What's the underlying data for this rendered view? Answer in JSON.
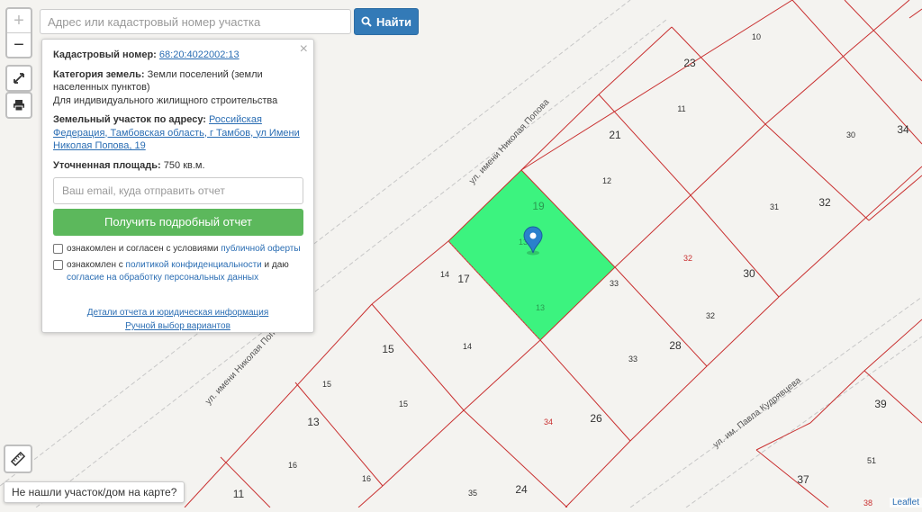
{
  "search": {
    "placeholder": "Адрес или кадастровый номер участка",
    "button_label": "Найти"
  },
  "controls": {
    "zoom_in": "+",
    "zoom_out": "−"
  },
  "popup": {
    "close": "×",
    "cadastral_label": "Кадастровый номер:",
    "cadastral_number": "68:20:4022002:13",
    "category_label": "Категория земель:",
    "category_value": "Земли поселений (земли населенных пунктов)",
    "usage": "Для индивидуального жилищного строительства",
    "address_label": "Земельный участок по адресу:",
    "address_value": "Российская Федерация, Тамбовская область, г Тамбов, ул Имени Николая Попова, 19",
    "area_label": "Уточненная площадь:",
    "area_value": "750 кв.м.",
    "email_placeholder": "Ваш email, куда отправить отчет",
    "report_button": "Получить подробный отчет",
    "consent1_text": "ознакомлен и согласен с условиями",
    "consent1_link": "публичной оферты",
    "consent2_text": "ознакомлен с",
    "consent2_link": "политикой конфиденциальности",
    "consent2_mid": "и даю",
    "consent2_link2": "согласие на обработку персональных данных",
    "details_link": "Детали отчета и юридическая информация",
    "manual_link": "Ручной выбор вариантов"
  },
  "not_found_button": "Не нашли участок/дом на карте?",
  "attribution": "Leaflet",
  "map": {
    "streets": [
      "ул. имени Николая Попова",
      "ул. имени Николая Попова",
      "ул. им. Павла Кудрявцева"
    ],
    "parcel_labels": [
      {
        "text": "10",
        "color": "dark",
        "size": "small"
      },
      {
        "text": "23",
        "color": "dark",
        "size": "big"
      },
      {
        "text": "11",
        "color": "dark",
        "size": "small"
      },
      {
        "text": "21",
        "color": "dark",
        "size": "big"
      },
      {
        "text": "30",
        "color": "dark",
        "size": "small"
      },
      {
        "text": "34",
        "color": "dark",
        "size": "big"
      },
      {
        "text": "12",
        "color": "dark",
        "size": "small"
      },
      {
        "text": "31",
        "color": "dark",
        "size": "small"
      },
      {
        "text": "32",
        "color": "dark",
        "size": "big"
      },
      {
        "text": "19",
        "color": "green",
        "size": "big"
      },
      {
        "text": "13",
        "color": "green",
        "size": "small"
      },
      {
        "text": "14",
        "color": "dark",
        "size": "small"
      },
      {
        "text": "17",
        "color": "dark",
        "size": "big"
      },
      {
        "text": "13",
        "color": "green",
        "size": "small"
      },
      {
        "text": "32",
        "color": "red",
        "size": "small"
      },
      {
        "text": "30",
        "color": "dark",
        "size": "big"
      },
      {
        "text": "33",
        "color": "dark",
        "size": "small"
      },
      {
        "text": "32",
        "color": "dark",
        "size": "small"
      },
      {
        "text": "15",
        "color": "dark",
        "size": "big"
      },
      {
        "text": "14",
        "color": "dark",
        "size": "small"
      },
      {
        "text": "28",
        "color": "dark",
        "size": "big"
      },
      {
        "text": "33",
        "color": "dark",
        "size": "small"
      },
      {
        "text": "15",
        "color": "dark",
        "size": "small"
      },
      {
        "text": "15",
        "color": "dark",
        "size": "small"
      },
      {
        "text": "13",
        "color": "dark",
        "size": "big"
      },
      {
        "text": "34",
        "color": "red",
        "size": "small"
      },
      {
        "text": "26",
        "color": "dark",
        "size": "big"
      },
      {
        "text": "16",
        "color": "dark",
        "size": "small"
      },
      {
        "text": "16",
        "color": "dark",
        "size": "small"
      },
      {
        "text": "11",
        "color": "dark",
        "size": "big"
      },
      {
        "text": "35",
        "color": "dark",
        "size": "small"
      },
      {
        "text": "24",
        "color": "dark",
        "size": "big"
      },
      {
        "text": "39",
        "color": "dark",
        "size": "big"
      },
      {
        "text": "51",
        "color": "dark",
        "size": "small"
      },
      {
        "text": "37",
        "color": "dark",
        "size": "big"
      },
      {
        "text": "38",
        "color": "red",
        "size": "small"
      }
    ]
  }
}
